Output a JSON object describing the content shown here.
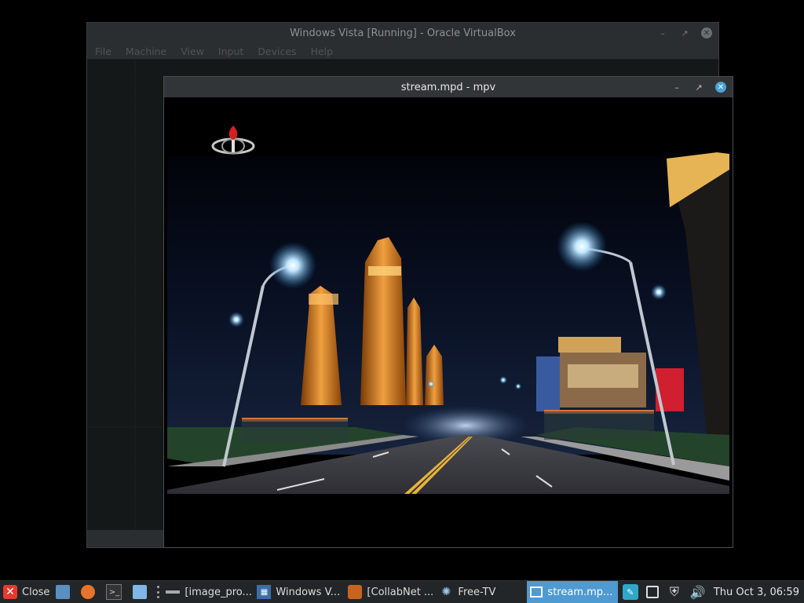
{
  "vbox": {
    "title": "Windows Vista [Running] - Oracle VirtualBox",
    "menu": [
      "File",
      "Machine",
      "View",
      "Input",
      "Devices",
      "Help"
    ]
  },
  "mpv": {
    "title": "stream.mpd - mpv",
    "video_description_icon": "broadcaster-logo-icon"
  },
  "taskbar": {
    "close_label": "Close",
    "tasks": [
      {
        "label": "[image_pro...",
        "icon": "image-viewer-icon"
      },
      {
        "label": "Windows V...",
        "icon": "virtualbox-icon"
      },
      {
        "label": "[CollabNet ...",
        "icon": "collabnet-icon"
      },
      {
        "label": "Free-TV",
        "icon": "freetv-icon"
      },
      {
        "label": "stream.mp...",
        "icon": "mpv-icon",
        "active": true
      }
    ],
    "clock": "Thu Oct  3, 06:59"
  },
  "colors": {
    "accent": "#4f9ad1",
    "close_red": "#e53a2e",
    "panel": "#232628"
  }
}
